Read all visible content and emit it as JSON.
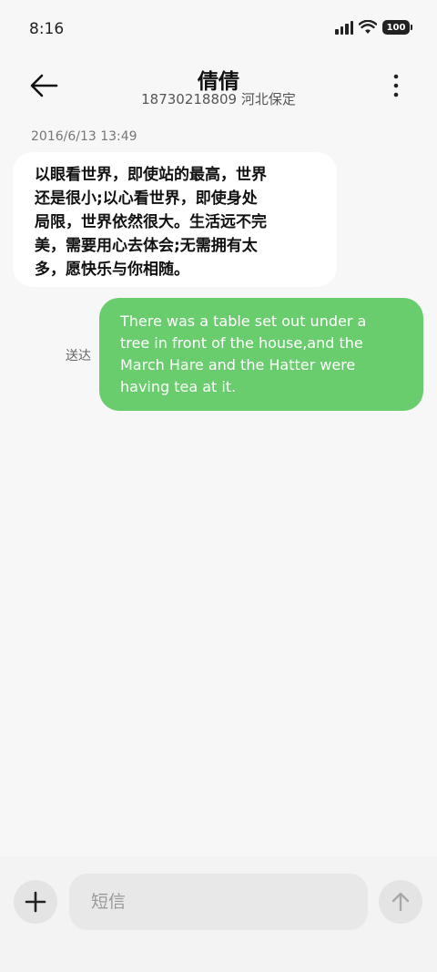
{
  "status_bar": {
    "time": "8:16",
    "battery": "100",
    "icons": [
      "signal-icon",
      "wifi-icon",
      "battery-icon"
    ]
  },
  "header": {
    "contact_name": "倩倩",
    "contact_sub": "18730218809 河北保定",
    "icons": [
      "back-arrow-icon",
      "more-vert-icon"
    ]
  },
  "conversation": {
    "timestamp": "2016/6/13 13:49",
    "incoming_lines": [
      "以眼看世界，即使站的最高，世界",
      "还是很小;以心看世界，即使身处",
      "局限，世界依然很大。生活远不完",
      "美，需要用心去体会;无需拥有太",
      "多，愿快乐与你相随。"
    ],
    "outgoing_lines": [
      "There was a table set out under a",
      "tree in front of the house,and the",
      "March Hare and the Hatter were",
      "having tea at it."
    ],
    "delivered_label": "送达"
  },
  "composer": {
    "placeholder": "短信",
    "icons": [
      "plus-icon",
      "send-arrow-icon"
    ]
  },
  "colors": {
    "background": "#f7f7f7",
    "incoming_bubble": "#ffffff",
    "outgoing_bubble": "#69cd6e"
  }
}
